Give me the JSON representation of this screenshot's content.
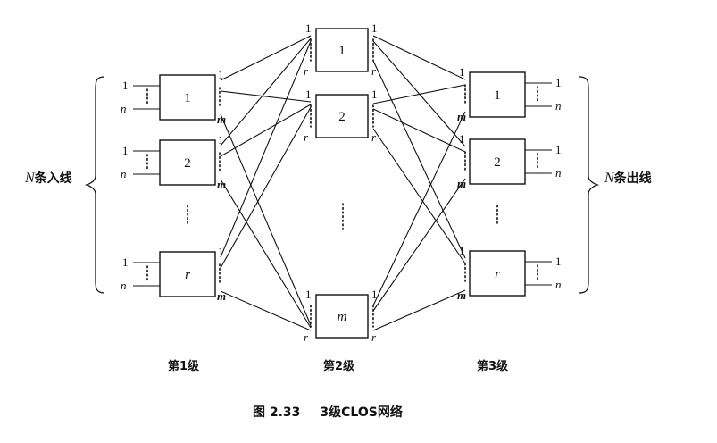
{
  "diagram": {
    "title": "3级CLOS网络",
    "figure_label": "图 2.33",
    "left_label_n": "N",
    "left_label_text": "条入线",
    "right_label_n": "N",
    "right_label_text": "条出线",
    "stage_labels": [
      "第1级",
      "第2级",
      "第3级"
    ],
    "stage1_boxes": [
      "1",
      "2",
      "r"
    ],
    "stage2_boxes": [
      "1",
      "2",
      "m"
    ],
    "stage3_boxes": [
      "1",
      "2",
      "r"
    ],
    "port_first": "1",
    "port_last_n": "n",
    "port_last_m": "m",
    "port_last_r": "r",
    "vertical_ellipsis": "⋮"
  }
}
